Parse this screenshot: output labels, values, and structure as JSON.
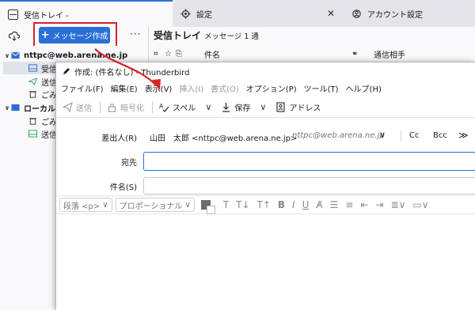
{
  "tabs": {
    "inbox": "受信トレイ -",
    "settings": "設定",
    "account": "アカウント設定"
  },
  "sidebar": {
    "new_message": "メッセージ作成",
    "more": "···",
    "items": [
      {
        "label": "nttpc@web.arena.ne.jp",
        "bold": true
      },
      {
        "label": "受信"
      },
      {
        "label": "送信"
      },
      {
        "label": "ごみ"
      },
      {
        "label": "ローカル",
        "bold": true
      },
      {
        "label": "ごみ"
      },
      {
        "label": "送信"
      }
    ]
  },
  "list": {
    "title": "受信トレイ",
    "count": "メッセージ 1 通",
    "col_subject": "件名",
    "col_correspondent": "通信相手"
  },
  "compose": {
    "title": "作成: (件名なし) - Thunderbird",
    "menu": [
      "ファイル(F)",
      "編集(E)",
      "表示(V)",
      "挿入(I)",
      "書式(O)",
      "オプション(P)",
      "ツール(T)",
      "ヘルプ(H)"
    ],
    "toolbar": {
      "send": "送信",
      "encrypt": "暗号化",
      "spell": "スペル",
      "save": "保存",
      "address": "アドレス"
    },
    "from_label": "差出人(R)",
    "from_value": "山田　太郎 <nttpc@web.arena.ne.jp>",
    "from_identity": "nttpc@web.arena.ne.jp",
    "cc": "Cc",
    "bcc": "Bcc",
    "more": "≫",
    "to_label": "宛先",
    "subject_label": "件名(S)",
    "format": {
      "paragraph": "段落 <p>",
      "font": "プロポーショナル"
    }
  },
  "colors": {
    "accent": "#2b6fd6",
    "annotation": "#d8232a"
  }
}
